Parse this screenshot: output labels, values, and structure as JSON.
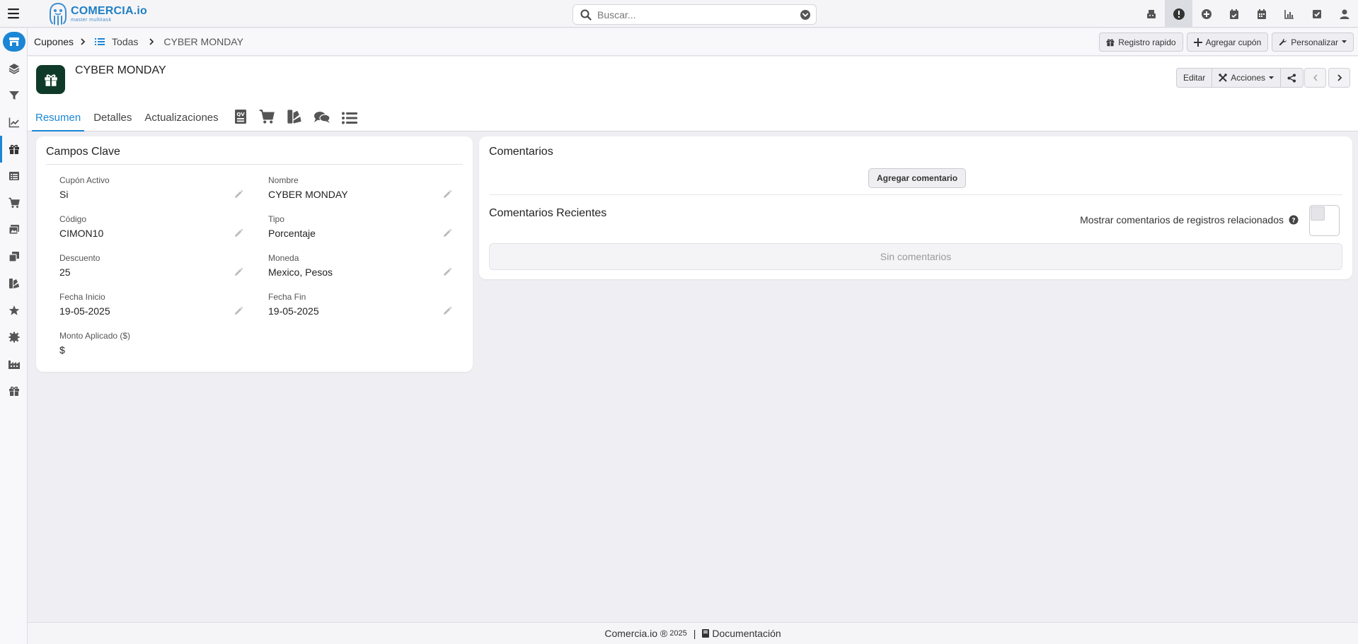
{
  "app": {
    "logo_main": "COMERCIA.io",
    "logo_sub": "master multitask",
    "accent": "#1b86d6"
  },
  "search": {
    "placeholder": "Buscar..."
  },
  "top_icons": [
    "register-icon",
    "alert-icon",
    "plus-circle-icon",
    "calendar-check-icon",
    "calendar-icon",
    "bar-chart-icon",
    "checkbox-icon",
    "user-icon"
  ],
  "sidebar": {
    "items": [
      "home-icon",
      "layers-icon",
      "filter-icon",
      "line-chart-icon",
      "gift-icon",
      "list-alt-icon",
      "cart-icon",
      "images-icon",
      "copy-icon",
      "swatches-icon",
      "star-icon",
      "gear-badge-icon",
      "industry-icon",
      "gift-icon"
    ]
  },
  "breadcrumb": {
    "module": "Cupones",
    "list": "Todas",
    "current": "CYBER MONDAY"
  },
  "subbar": {
    "quick_register": "Registro rapido",
    "add_coupon": "Agregar cupón",
    "customize": "Personalizar"
  },
  "record": {
    "title": "CYBER MONDAY",
    "edit": "Editar",
    "actions": "Acciones"
  },
  "tabs": {
    "summary": "Resumen",
    "details": "Detalles",
    "updates": "Actualizaciones"
  },
  "key_fields": {
    "title": "Campos Clave",
    "active_label": "Cupón Activo",
    "active_value": "Si",
    "name_label": "Nombre",
    "name_value": "CYBER MONDAY",
    "code_label": "Código",
    "code_value": "CIMON10",
    "type_label": "Tipo",
    "type_value": "Porcentaje",
    "discount_label": "Descuento",
    "discount_value": "25",
    "currency_label": "Moneda",
    "currency_value": "Mexico, Pesos",
    "start_label": "Fecha Inicio",
    "start_value": "19-05-2025",
    "end_label": "Fecha Fin",
    "end_value": "19-05-2025",
    "amount_label": "Monto Aplicado ($)",
    "amount_value": "$"
  },
  "comments": {
    "title": "Comentarios",
    "add_button": "Agregar comentario",
    "recent_title": "Comentarios Recientes",
    "related_label": "Mostrar comentarios de registros relacionados",
    "empty": "Sin comentarios"
  },
  "footer": {
    "brand": "Comercia.io ®",
    "year": "2025",
    "separator": "|",
    "docs": "Documentación"
  }
}
